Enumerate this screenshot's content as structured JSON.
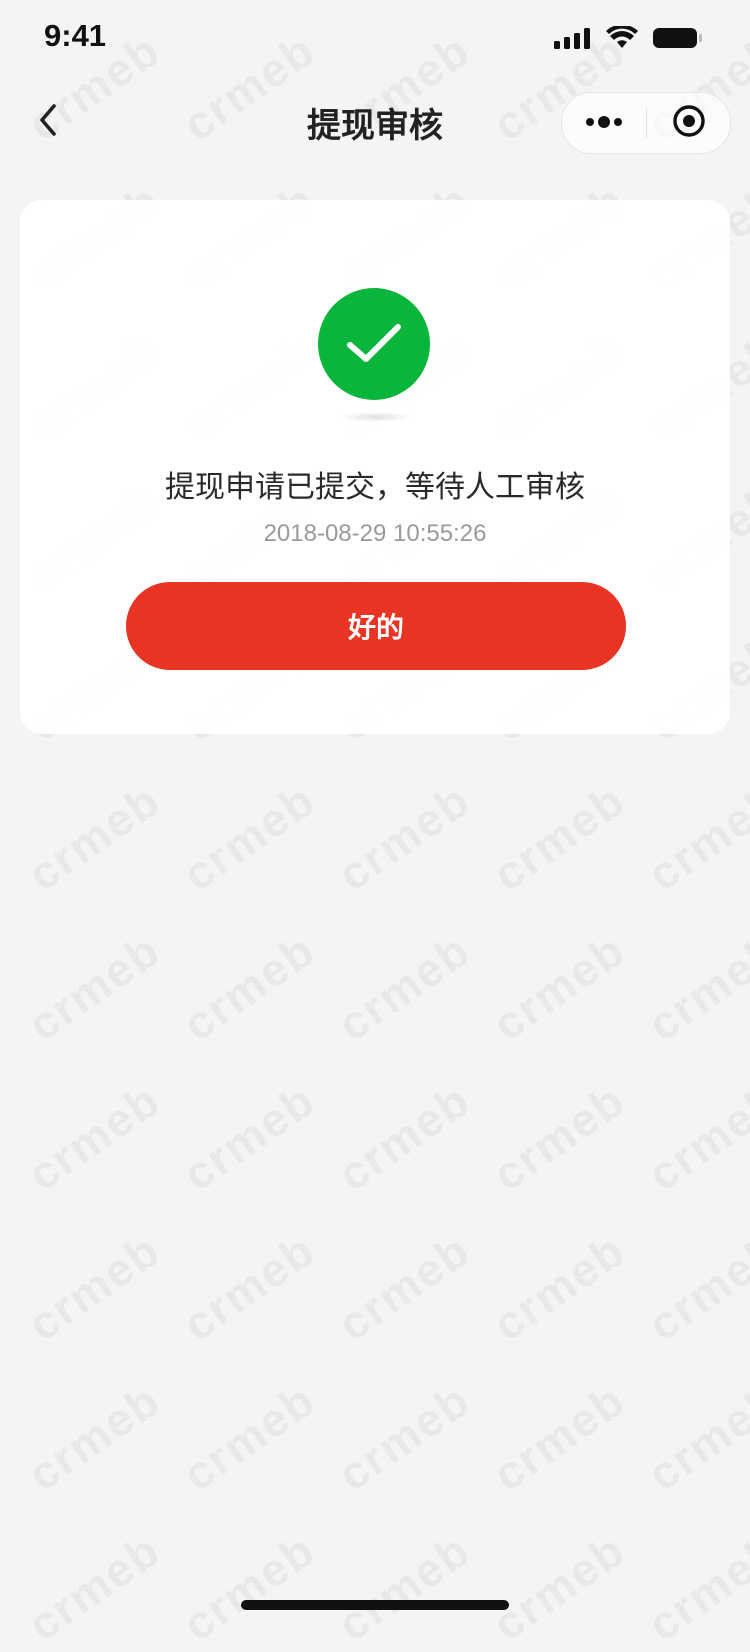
{
  "status_bar": {
    "time": "9:41"
  },
  "nav": {
    "title": "提现审核",
    "back_icon": "chevron-left-icon",
    "more_icon": "more-dots-icon",
    "close_icon": "target-circle-icon"
  },
  "result": {
    "icon": "check-circle-icon",
    "message": "提现申请已提交，等待人工审核",
    "timestamp": "2018-08-29 10:55:26",
    "button_label": "好的"
  },
  "colors": {
    "success": "#09b53a",
    "primary_button": "#e93323",
    "background": "#f4f4f4",
    "card": "#ffffff",
    "watermark": "#e7e7e7"
  },
  "watermark": {
    "text": "crmeb"
  }
}
